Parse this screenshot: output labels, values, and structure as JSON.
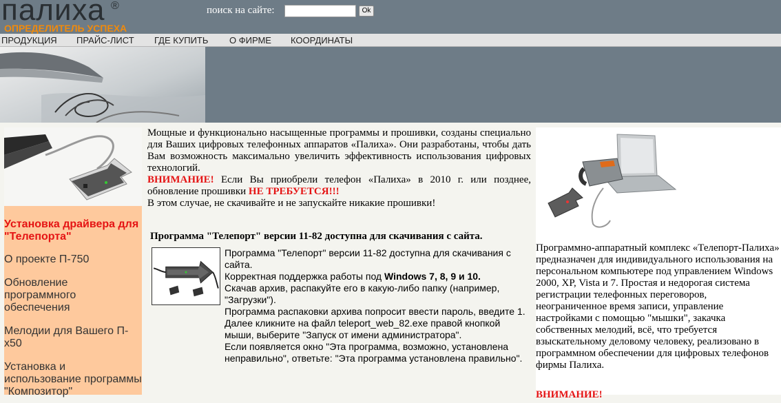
{
  "header": {
    "logo_text": "палиха",
    "logo_reg": "®",
    "slogan": "ОПРЕДЕЛИТЕЛЬ УСПЕХА",
    "search_label": "поиск на сайте:",
    "search_value": "",
    "search_button": "Ok"
  },
  "nav": {
    "items": [
      {
        "label": "ПРОДУКЦИЯ"
      },
      {
        "label": "ПРАЙС-ЛИСТ"
      },
      {
        "label": "ГДЕ КУПИТЬ"
      },
      {
        "label": "О ФИРМЕ"
      },
      {
        "label": "КООРДИНАТЫ"
      }
    ]
  },
  "left": {
    "links": [
      {
        "label": "Установка драйвера для \"Телепорта\""
      },
      {
        "label": "О проекте П-750"
      },
      {
        "label": "Обновление программного обеспечения"
      },
      {
        "label": "Мелодии для Вашего П-х50"
      },
      {
        "label": "Установка и использование программы \"Композитор\""
      }
    ]
  },
  "center": {
    "intro": "Мощные и функционально насыщенные программы и прошивки, созданы специально для Ваших цифровых телефонных аппаратов «Палиха». Они разработаны, чтобы дать Вам возможность максимально увеличить эффективность использования цифровых технологий.",
    "warn_label": "ВНИМАНИЕ!",
    "warn_text": " Если Вы приобрели телефон «Палиха» в 2010 г. или позднее, обновление прошивки ",
    "warn_strong": "НЕ ТРЕБУЕТСЯ!!!",
    "warn_after": "В этом случае, не скачивайте и не запускайте никакие прошивки!",
    "subheading": "Программа \"Телепорт\" версии 11-82 доступна для скачивания с сайта.",
    "prog_line1": "Программа \"Телепорт\" версии 11-82 доступна для скачивания с сайта.",
    "prog_line2a": "Корректная поддержка работы под ",
    "prog_line2b": "Windows 7, 8, 9 и 10.",
    "prog_line3": "Скачав архив, распакуйте его в какую-либо папку (например, \"Загрузки\").",
    "prog_line4": "Программа распаковки архива попросит ввести пароль, введите 1.",
    "prog_line5": "Далее кликните на файл teleport_web_82.exe правой кнопкой мыши, выберите \"Запуск от имени администратора\".",
    "prog_line6": "Если появляется окно \"Эта программа, возможно, установлена неправильно\", ответьте: \"Эта программа установлена правильно\"."
  },
  "right": {
    "description": "Программно-аппаратный комплекс «Телепорт-Палиха» предназначен для индивидуального использования на персональном компьютере под управлением Windows 2000, XP, Vista и 7. Простая и недорогая система регистрации телефонных переговоров, неограниченное время записи, управление настройками с помощью \"мышки\", закачка собственных мелодий, всё, что требуется взыскательному деловому человеку, реализовано в программном обеспечении для цифровых телефонов фирмы Палиха.",
    "warn": "ВНИМАНИЕ!"
  },
  "colors": {
    "header_bg": "#6e7c87",
    "accent_orange": "#f08a0c",
    "sidebar_bg": "#fec99d",
    "warning_red": "#e51414"
  }
}
